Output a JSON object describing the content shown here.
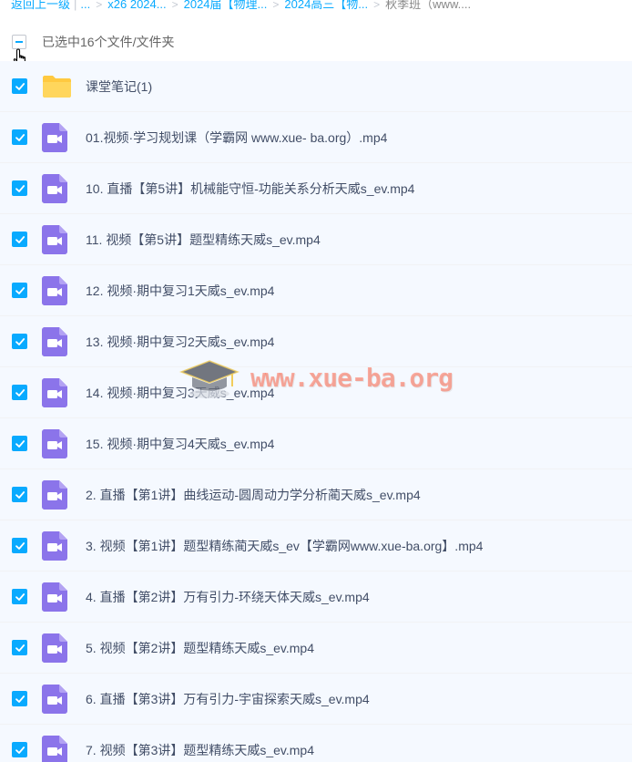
{
  "breadcrumb": {
    "back": "返回上一级",
    "ellipsis": "...",
    "crumbs": [
      "x26 2024...",
      "2024届【物理...",
      "2024高三【物...",
      "秋季班（www...."
    ]
  },
  "header": {
    "selection_text": "已选中16个文件/文件夹"
  },
  "files": [
    {
      "name": "课堂笔记(1)",
      "type": "folder",
      "checked": true
    },
    {
      "name": "01.视频·学习规划课（学霸网 www.xue- ba.org）.mp4",
      "type": "video",
      "checked": true
    },
    {
      "name": "10. 直播【第5讲】机械能守恒-功能关系分析天威s_ev.mp4",
      "type": "video",
      "checked": true
    },
    {
      "name": "11. 视频【第5讲】题型精练天威s_ev.mp4",
      "type": "video",
      "checked": true
    },
    {
      "name": "12. 视频·期中复习1天威s_ev.mp4",
      "type": "video",
      "checked": true
    },
    {
      "name": "13. 视频·期中复习2天威s_ev.mp4",
      "type": "video",
      "checked": true
    },
    {
      "name": "14. 视频·期中复习3天威s_ev.mp4",
      "type": "video",
      "checked": true
    },
    {
      "name": "15. 视频·期中复习4天威s_ev.mp4",
      "type": "video",
      "checked": true
    },
    {
      "name": "2. 直播【第1讲】曲线运动-圆周动力学分析蔺天威s_ev.mp4",
      "type": "video",
      "checked": true
    },
    {
      "name": "3. 视频【第1讲】题型精练蔺天威s_ev【学霸网www.xue-ba.org】.mp4",
      "type": "video",
      "checked": true
    },
    {
      "name": "4. 直播【第2讲】万有引力-环绕天体天威s_ev.mp4",
      "type": "video",
      "checked": true
    },
    {
      "name": "5. 视频【第2讲】题型精练天威s_ev.mp4",
      "type": "video",
      "checked": true
    },
    {
      "name": "6. 直播【第3讲】万有引力-宇宙探索天威s_ev.mp4",
      "type": "video",
      "checked": true
    },
    {
      "name": "7. 视频【第3讲】题型精练天威s_ev.mp4",
      "type": "video",
      "checked": true
    }
  ],
  "watermark": {
    "text": "www.xue-ba.org"
  },
  "colors": {
    "accent": "#09aaff",
    "video_icon": "#8b74ea",
    "folder_icon": "#ffc940"
  }
}
